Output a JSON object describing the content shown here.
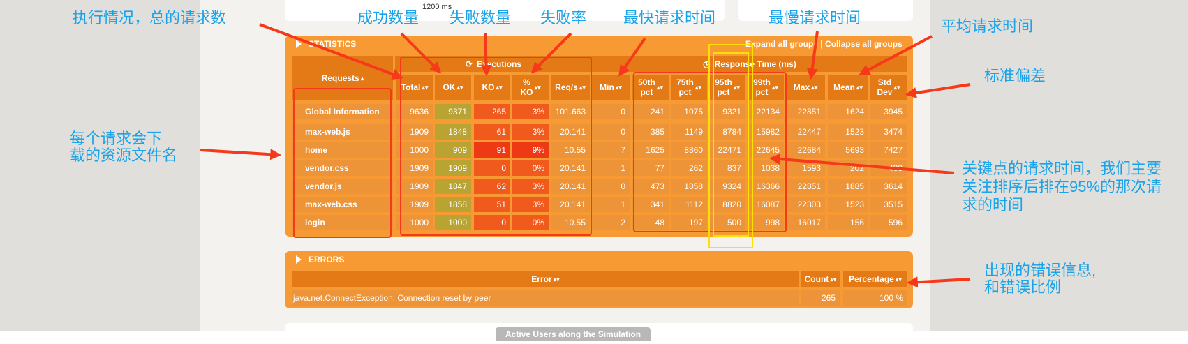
{
  "timeline": {
    "ms_label": "1200 ms"
  },
  "statistics": {
    "title": "STATISTICS",
    "expand_collapse": "Expand all groups | Collapse all groups",
    "executions_header": "Executions",
    "response_time_header": "Response Time (ms)",
    "requests_header": "Requests",
    "columns": [
      {
        "label": "Total"
      },
      {
        "label": "OK"
      },
      {
        "label": "KO"
      },
      {
        "label": "% KO",
        "line1": "%",
        "line2": "KO"
      },
      {
        "label": "Req/s"
      },
      {
        "label": "Min"
      },
      {
        "label": "50th pct",
        "line1": "50th",
        "line2": "pct"
      },
      {
        "label": "75th pct",
        "line1": "75th",
        "line2": "pct"
      },
      {
        "label": "95th pct",
        "line1": "95th",
        "line2": "pct"
      },
      {
        "label": "99th pct",
        "line1": "99th",
        "line2": "pct"
      },
      {
        "label": "Max"
      },
      {
        "label": "Mean"
      },
      {
        "label": "Std Dev",
        "line1": "Std",
        "line2": "Dev"
      }
    ],
    "rows": [
      {
        "name": "Global Information",
        "values": [
          "9636",
          "9371",
          "265",
          "3%",
          "101.663",
          "0",
          "241",
          "1075",
          "9321",
          "22134",
          "22851",
          "1624",
          "3945"
        ]
      },
      {
        "name": "max-web.js",
        "values": [
          "1909",
          "1848",
          "61",
          "3%",
          "20.141",
          "0",
          "385",
          "1149",
          "8784",
          "15982",
          "22447",
          "1523",
          "3474"
        ]
      },
      {
        "name": "home",
        "values": [
          "1000",
          "909",
          "91",
          "9%",
          "10.55",
          "7",
          "1625",
          "8860",
          "22471",
          "22645",
          "22684",
          "5693",
          "7427"
        ]
      },
      {
        "name": "vendor.css",
        "values": [
          "1909",
          "1909",
          "0",
          "0%",
          "20.141",
          "1",
          "77",
          "262",
          "837",
          "1038",
          "1593",
          "202",
          "488"
        ]
      },
      {
        "name": "vendor.js",
        "values": [
          "1909",
          "1847",
          "62",
          "3%",
          "20.141",
          "0",
          "473",
          "1858",
          "9324",
          "16366",
          "22851",
          "1885",
          "3614"
        ]
      },
      {
        "name": "max-web.css",
        "values": [
          "1909",
          "1858",
          "51",
          "3%",
          "20.141",
          "1",
          "341",
          "1112",
          "8820",
          "16087",
          "22303",
          "1523",
          "3515"
        ]
      },
      {
        "name": "login",
        "values": [
          "1000",
          "1000",
          "0",
          "0%",
          "10.55",
          "2",
          "48",
          "197",
          "500",
          "998",
          "16017",
          "156",
          "596"
        ]
      }
    ]
  },
  "errors": {
    "title": "ERRORS",
    "headers": {
      "error": "Error",
      "count": "Count",
      "percentage": "Percentage"
    },
    "rows": [
      {
        "error": "java.net.ConnectException: Connection reset by peer",
        "count": "265",
        "percentage": "100 %"
      }
    ]
  },
  "bottom_panel": {
    "title": "Active Users along the Simulation"
  },
  "annotations": {
    "total": "执行情况，总的请求数",
    "ok": "成功数量",
    "ko": "失败数量",
    "ko_rate": "失败率",
    "min": "最快请求时间",
    "max": "最慢请求时间",
    "mean": "平均请求时间",
    "stddev": "标准偏差",
    "filename_line1": "每个请求会下",
    "filename_line2": "载的资源文件名",
    "pct95_line1": "关键点的请求时间，我们主要",
    "pct95_line2": "关注排序后排在95%的那次请",
    "pct95_line3": "求的时间",
    "errors_line1": "出现的错误信息,",
    "errors_line2": "和错误比例"
  },
  "colors": {
    "panel": "#f89a33",
    "header": "#e47a16",
    "ok_cell": "#b9a332",
    "ko_cell": "#f05a1c",
    "annotation_text": "#1aa3e8",
    "annotation_arrow": "#f5391a",
    "highlight_95th": "#ffe000"
  }
}
